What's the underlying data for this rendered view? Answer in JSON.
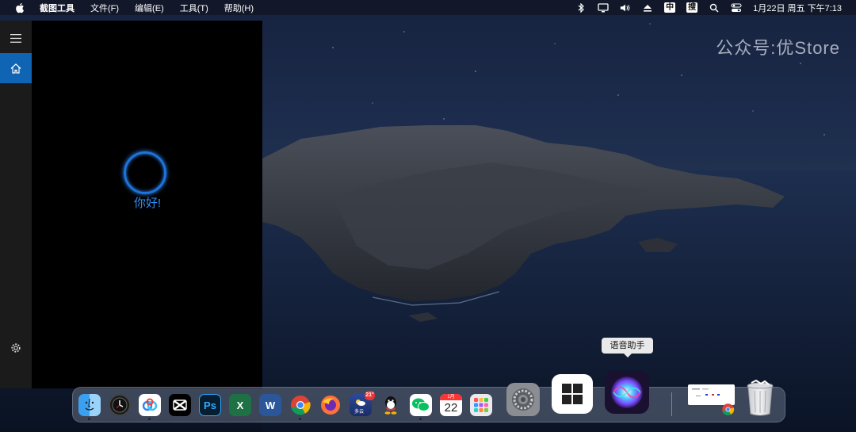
{
  "menubar": {
    "app_name": "截图工具",
    "menus": [
      "文件(F)",
      "编辑(E)",
      "工具(T)",
      "帮助(H)"
    ],
    "ime_label": "中",
    "sogou_label": "搜",
    "datetime": "1月22日 周五 下午7:13"
  },
  "cortana": {
    "greeting": "你好!"
  },
  "watermark": "公众号:优Store",
  "tooltip": "语音助手",
  "dock": {
    "apps": [
      {
        "name": "Finder"
      },
      {
        "name": "Clock"
      },
      {
        "name": "Baidu Netdisk"
      },
      {
        "name": "CapCut"
      },
      {
        "name": "Photoshop",
        "label": "Ps"
      },
      {
        "name": "Excel",
        "label": "X"
      },
      {
        "name": "Word",
        "label": "W"
      },
      {
        "name": "Chrome"
      },
      {
        "name": "Firefox"
      },
      {
        "name": "Weather",
        "badge": "21°",
        "caption": "多云"
      },
      {
        "name": "QQ"
      },
      {
        "name": "WeChat"
      },
      {
        "name": "Calendar",
        "month": "1月",
        "day": "22"
      },
      {
        "name": "Launchpad"
      },
      {
        "name": "System Preferences"
      },
      {
        "name": "Windows Start"
      },
      {
        "name": "Siri"
      },
      {
        "name": "Window preview"
      },
      {
        "name": "Trash"
      }
    ]
  },
  "colors": {
    "accent": "#0f64b4",
    "cortana_ring": "#1e74d8",
    "greeting_text": "#2e8ff5"
  }
}
